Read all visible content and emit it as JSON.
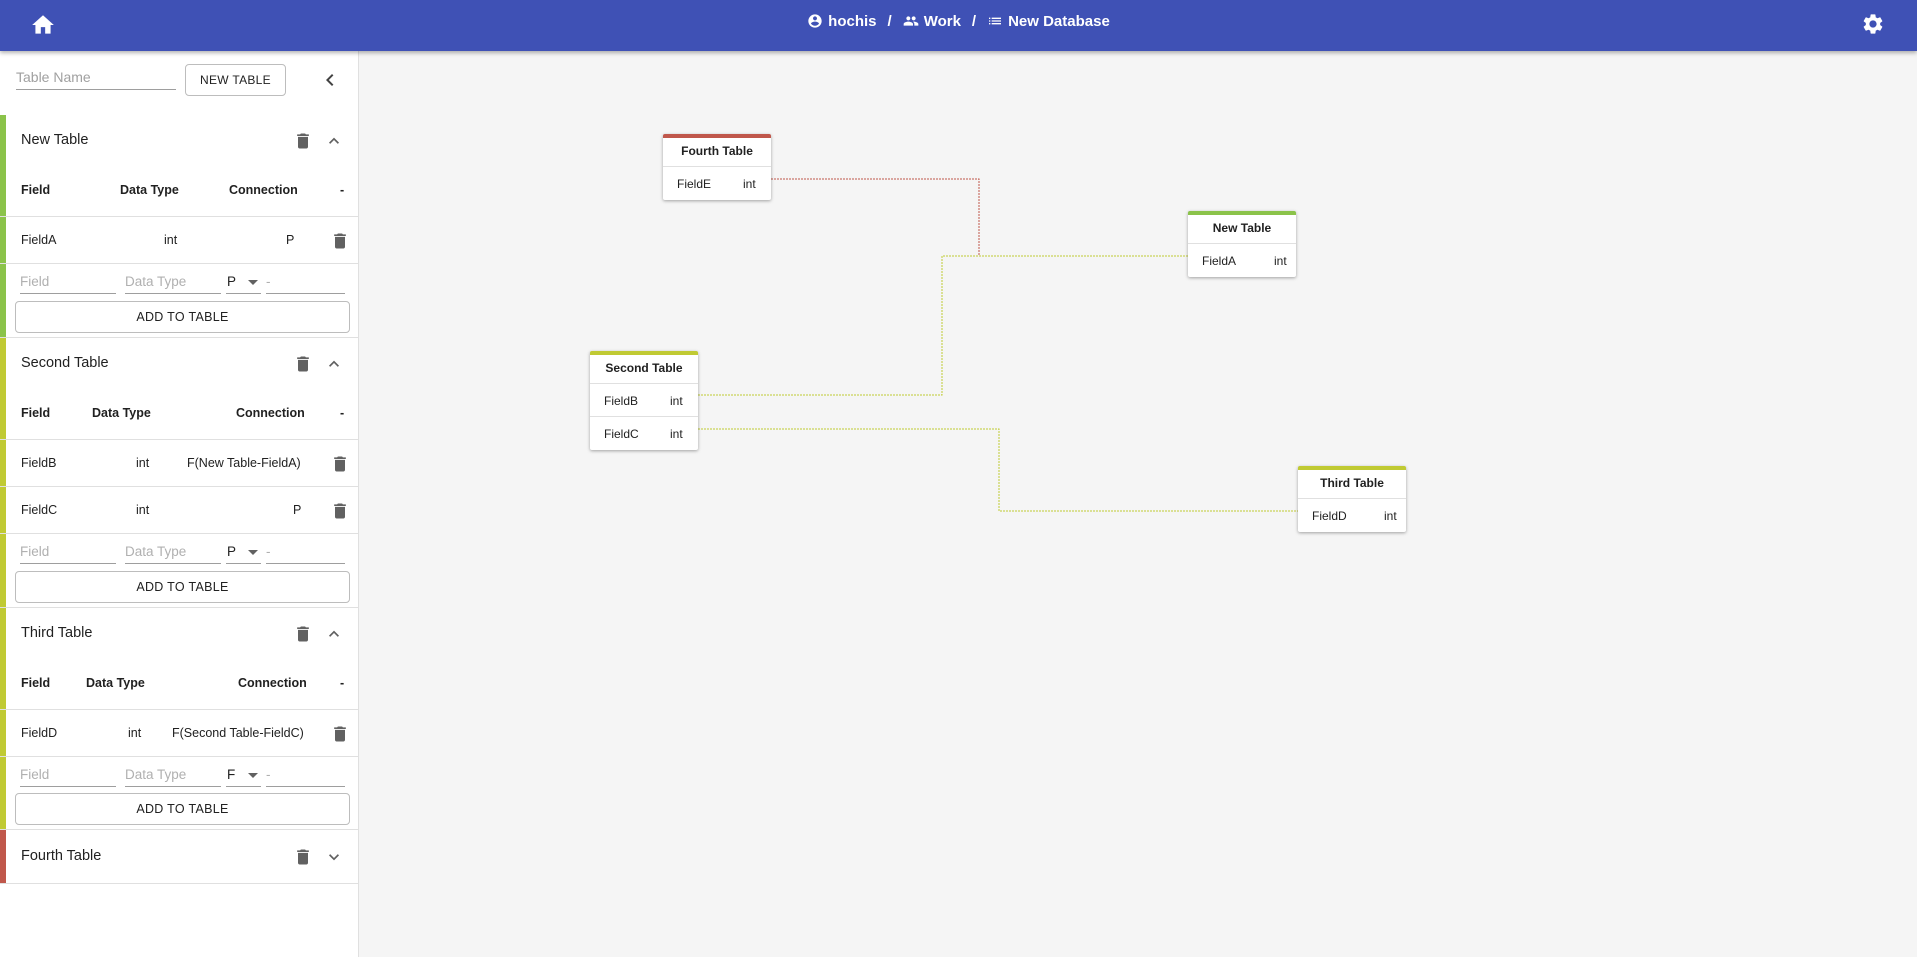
{
  "colors": {
    "appbar": "#3f51b5",
    "green": "#8bc34a",
    "lime": "#c0ca33",
    "red": "#c0574b"
  },
  "appbar": {
    "home_icon": "home-icon",
    "settings_icon": "gear-icon",
    "breadcrumb": [
      {
        "icon": "account-circle-icon",
        "label": "hochis"
      },
      {
        "icon": "group-icon",
        "label": "Work"
      },
      {
        "icon": "list-icon",
        "label": "New Database"
      }
    ],
    "separator": "/"
  },
  "sidebar": {
    "table_name_placeholder": "Table Name",
    "new_table_label": "NEW TABLE",
    "columns": {
      "field": "Field",
      "data_type": "Data Type",
      "connection": "Connection",
      "dash": "-"
    },
    "add_placeholders": {
      "field": "Field",
      "data_type": "Data Type",
      "connection": "-"
    },
    "add_button_label": "ADD TO TABLE",
    "tables": [
      {
        "name": "New Table",
        "expanded": true,
        "rows": [
          {
            "field": "FieldA",
            "type": "int",
            "connection": "P"
          }
        ],
        "new_key": "P"
      },
      {
        "name": "Second Table",
        "expanded": true,
        "rows": [
          {
            "field": "FieldB",
            "type": "int",
            "connection": "F(New Table-FieldA)"
          },
          {
            "field": "FieldC",
            "type": "int",
            "connection": "P"
          }
        ],
        "new_key": "P"
      },
      {
        "name": "Third Table",
        "expanded": true,
        "rows": [
          {
            "field": "FieldD",
            "type": "int",
            "connection": "F(Second Table-FieldC)"
          }
        ],
        "new_key": "F"
      },
      {
        "name": "Fourth Table",
        "expanded": false
      }
    ]
  },
  "diagram": {
    "cards": [
      {
        "title": "Fourth Table",
        "rows": [
          {
            "field": "FieldE",
            "type": "int"
          }
        ]
      },
      {
        "title": "New Table",
        "rows": [
          {
            "field": "FieldA",
            "type": "int"
          }
        ]
      },
      {
        "title": "Second Table",
        "rows": [
          {
            "field": "FieldB",
            "type": "int"
          },
          {
            "field": "FieldC",
            "type": "int"
          }
        ]
      },
      {
        "title": "Third Table",
        "rows": [
          {
            "field": "FieldD",
            "type": "int"
          }
        ]
      }
    ]
  }
}
